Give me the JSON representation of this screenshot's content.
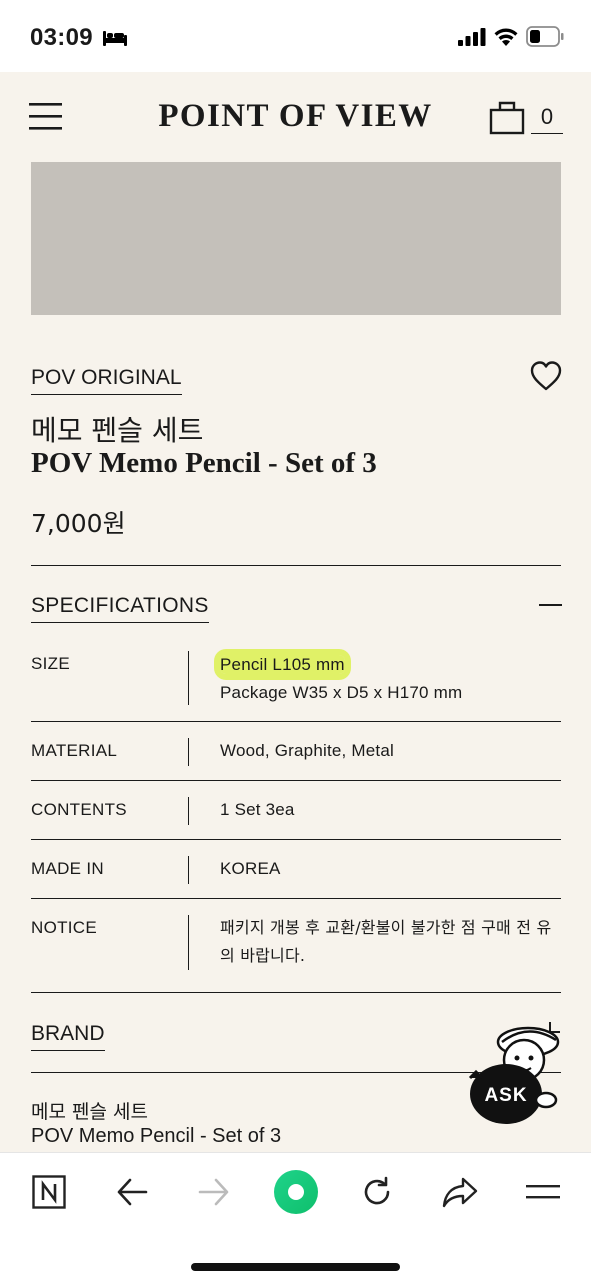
{
  "status_bar": {
    "time": "03:09",
    "icons": [
      "sleep-bed-icon",
      "cellular-signal-icon",
      "wifi-icon",
      "battery-icon"
    ]
  },
  "header": {
    "logo": "POINT OF VIEW",
    "cart_count": "0",
    "icons": [
      "hamburger-menu-icon",
      "shopping-bag-icon"
    ]
  },
  "product": {
    "brand_link": "POV ORIGINAL",
    "name_ko": "메모 펜슬 세트",
    "name_en": "POV Memo Pencil - Set of 3",
    "price": "7,000원"
  },
  "specifications": {
    "title": "SPECIFICATIONS",
    "rows": [
      {
        "label": "SIZE",
        "values": [
          "Pencil L105 mm",
          "Package W35 x D5 x H170 mm"
        ]
      },
      {
        "label": "MATERIAL",
        "values": [
          "Wood, Graphite, Metal"
        ]
      },
      {
        "label": "CONTENTS",
        "values": [
          "1 Set 3ea"
        ]
      },
      {
        "label": "MADE IN",
        "values": [
          "KOREA"
        ]
      },
      {
        "label": "NOTICE",
        "values": [
          "패키지 개봉 후 교환/환불이 불가한 점 구매 전 유의 바랍니다."
        ]
      }
    ]
  },
  "brand_section": {
    "title": "BRAND",
    "name_ko": "메모 펜슬 세트",
    "name_en": "POV Memo Pencil - Set of 3"
  },
  "chat_widget": {
    "label": "ASK"
  },
  "toolbar": {
    "icons": [
      "naver-n-icon",
      "back-arrow-icon",
      "forward-arrow-icon",
      "green-dot-icon",
      "reload-icon",
      "share-icon",
      "menu-icon"
    ]
  },
  "colors": {
    "background": "#f7f3ec",
    "text": "#1a1a1a",
    "image_placeholder": "#c4c0ba",
    "highlight": "#dcf050",
    "accent_green": "#1fd38a"
  }
}
